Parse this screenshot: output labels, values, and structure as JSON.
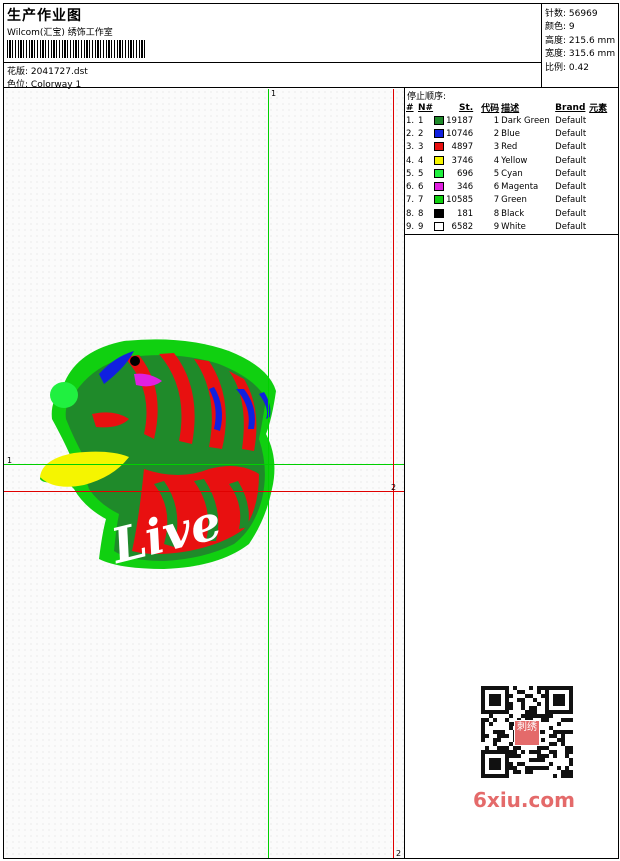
{
  "header": {
    "title": "生产作业图",
    "subtitle": "Wilcom(汇宝) 绣饰工作室",
    "design_label": "花版:",
    "design_value": "2041727.dst",
    "colorway_label": "色位:",
    "colorway_value": "Colorway 1"
  },
  "stats": {
    "stitches_label": "针数:",
    "stitches_value": "56969",
    "colors_label": "颜色:",
    "colors_value": "9",
    "height_label": "高度:",
    "height_value": "215.6 mm",
    "width_label": "宽度:",
    "width_value": "315.6 mm",
    "scale_label": "比例:",
    "scale_value": "0.42"
  },
  "stops": {
    "title": "停止顺序:",
    "columns": [
      "#",
      "N#",
      "St.",
      "代码",
      "描述",
      "Brand",
      "元素"
    ],
    "rows": [
      {
        "num": "1.",
        "n": "1",
        "st": "19187",
        "code": "1",
        "desc": "Dark Green",
        "brand": "Default",
        "color": "#1f8a2a"
      },
      {
        "num": "2.",
        "n": "2",
        "st": "10746",
        "code": "2",
        "desc": "Blue",
        "brand": "Default",
        "color": "#1020e0"
      },
      {
        "num": "3.",
        "n": "3",
        "st": "4897",
        "code": "3",
        "desc": "Red",
        "brand": "Default",
        "color": "#e81010"
      },
      {
        "num": "4.",
        "n": "4",
        "st": "3746",
        "code": "4",
        "desc": "Yellow",
        "brand": "Default",
        "color": "#f5f500"
      },
      {
        "num": "5.",
        "n": "5",
        "st": "696",
        "code": "5",
        "desc": "Cyan",
        "brand": "Default",
        "color": "#20f040"
      },
      {
        "num": "6.",
        "n": "6",
        "st": "346",
        "code": "6",
        "desc": "Magenta",
        "brand": "Default",
        "color": "#e020e0"
      },
      {
        "num": "7.",
        "n": "7",
        "st": "10585",
        "code": "7",
        "desc": "Green",
        "brand": "Default",
        "color": "#10d010"
      },
      {
        "num": "8.",
        "n": "8",
        "st": "181",
        "code": "8",
        "desc": "Black",
        "brand": "Default",
        "color": "#000000"
      },
      {
        "num": "9.",
        "n": "9",
        "st": "6582",
        "code": "9",
        "desc": "White",
        "brand": "Default",
        "color": "#ffffff"
      }
    ]
  },
  "guides": {
    "green_v_label": "1",
    "green_h_label": "1",
    "red_h_label": "2",
    "red_v_label": "2"
  },
  "design": {
    "text": "Live"
  },
  "watermark": {
    "text": "6xiu.com",
    "seal_text": "刺绣"
  }
}
